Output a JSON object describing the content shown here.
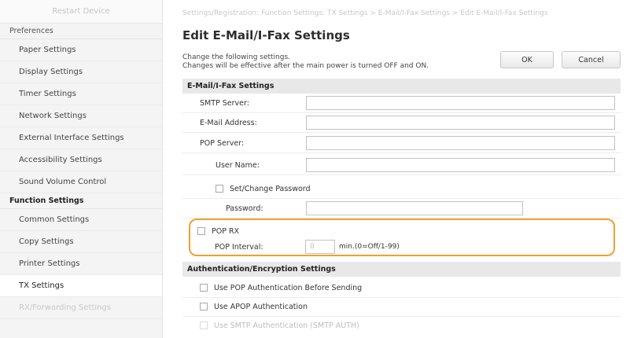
{
  "sidebar": {
    "restart_label": "Restart Device",
    "preferences_header": "Preferences",
    "preferences_items": [
      "Paper Settings",
      "Display Settings",
      "Timer Settings",
      "Network Settings",
      "External Interface Settings",
      "Accessibility Settings",
      "Sound Volume Control"
    ],
    "function_header": "Function Settings",
    "function_items": [
      "Common Settings",
      "Copy Settings",
      "Printer Settings",
      "TX Settings",
      "RX/Forwarding Settings"
    ]
  },
  "main": {
    "breadcrumb": "Settings/Registration: Function Settings: TX Settings > E-Mail/I-Fax Settings > Edit E-Mail/I-Fax Settings",
    "title": "Edit E-Mail/I-Fax Settings",
    "desc_line1": "Change the following settings.",
    "desc_line2": "Changes will be effective after the main power is turned OFF and ON.",
    "ok_label": "OK",
    "cancel_label": "Cancel",
    "section1_title": "E-Mail/I-Fax Settings",
    "smtp_label": "SMTP Server:",
    "email_label": "E-Mail Address:",
    "pop_label": "POP Server:",
    "username_label": "User Name:",
    "setpw_label": "Set/Change Password",
    "password_label": "Password:",
    "poprx_label": "POP RX",
    "interval_label": "POP Interval:",
    "interval_value": "0",
    "interval_unit": "min.(0=Off/1-99)",
    "section2_title": "Authentication/Encryption Settings",
    "auth_options": [
      "Use POP Authentication Before Sending",
      "Use APOP Authentication",
      "Use SMTP Authentication (SMTP AUTH)"
    ]
  },
  "colors": {
    "highlight": "#f0a030",
    "section_bar": "#e8e8e8",
    "sidebar_bg": "#f4f4f4"
  }
}
